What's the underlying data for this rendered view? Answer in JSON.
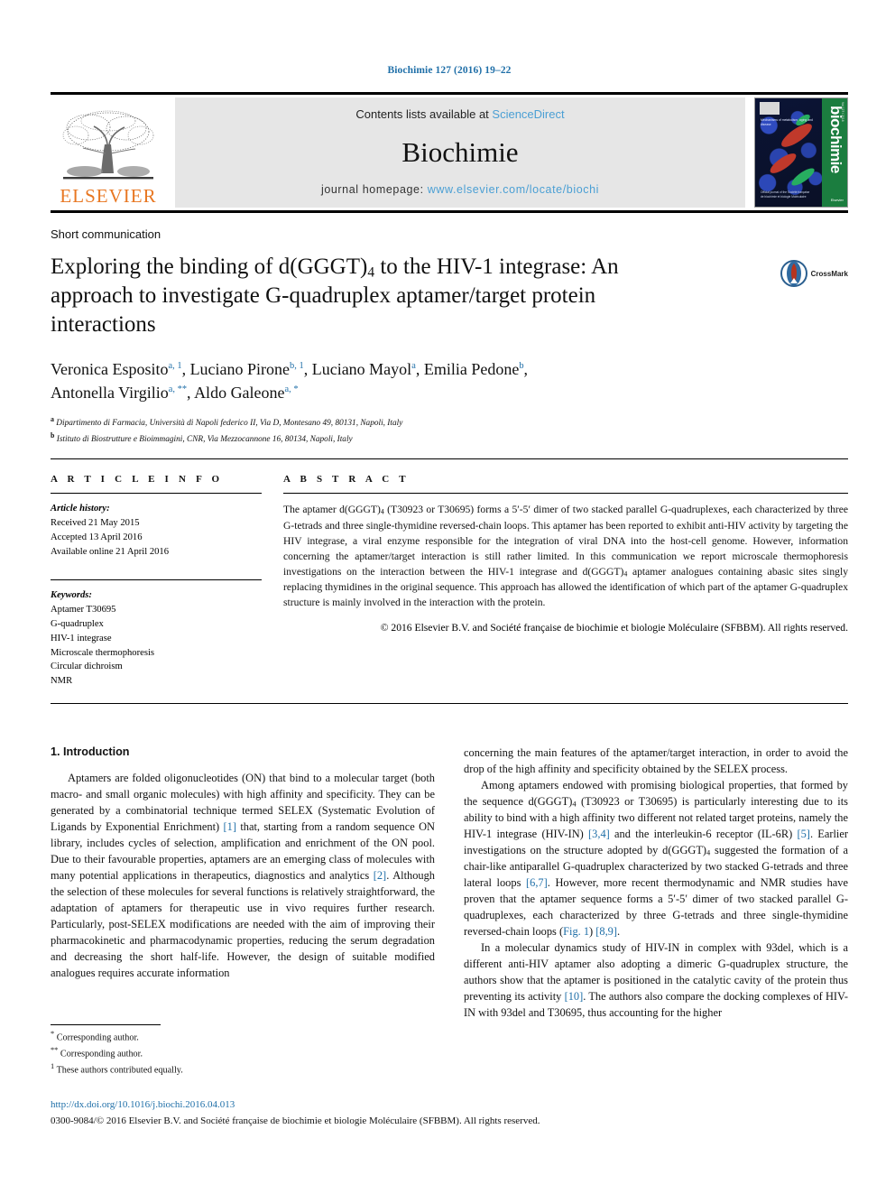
{
  "running_head": "Biochimie 127 (2016) 19–22",
  "masthead": {
    "publisher_name": "ELSEVIER",
    "contents_prefix": "Contents lists available at ",
    "contents_link": "ScienceDirect",
    "journal_name": "Biochimie",
    "homepage_label": "journal homepage: ",
    "homepage_url": "www.elsevier.com/locate/biochi",
    "cover_title": "biochimie",
    "cover_volume": "Vol 127 / 2016",
    "cover_caption": "Mechanisms of metabolism, aging and disease",
    "cover_caption2": "Official journal of the Société française de biochimie et biologie Moléculaire",
    "cover_badge": "Elsevier"
  },
  "article": {
    "type": "Short communication",
    "title_part1": "Exploring the binding of d(GGGT)",
    "title_sub1": "4",
    "title_part2": " to the HIV-1 integrase: An approach to investigate G-quadruplex aptamer/target protein interactions",
    "crossmark_label": "CrossMark"
  },
  "authors": {
    "line1": "Veronica Esposito",
    "line_html": "authors",
    "list": [
      {
        "name": "Veronica Esposito",
        "marks": "a, 1"
      },
      {
        "name": "Luciano Pirone",
        "marks": "b, 1"
      },
      {
        "name": "Luciano Mayol",
        "marks": "a"
      },
      {
        "name": "Emilia Pedone",
        "marks": "b"
      },
      {
        "name": "Antonella Virgilio",
        "marks": "a, **"
      },
      {
        "name": "Aldo Galeone",
        "marks": "a, *"
      }
    ],
    "affiliations": [
      {
        "mark": "a",
        "text": "Dipartimento di Farmacia, Università di Napoli federico II, Via D, Montesano 49, 80131, Napoli, Italy"
      },
      {
        "mark": "b",
        "text": "Istituto di Biostrutture e Bioimmagini, CNR, Via Mezzocannone 16, 80134, Napoli, Italy"
      }
    ]
  },
  "article_info": {
    "heading": "A R T I C L E  I N F O",
    "history_label": "Article history:",
    "history": [
      "Received 21 May 2015",
      "Accepted 13 April 2016",
      "Available online 21 April 2016"
    ],
    "keywords_label": "Keywords:",
    "keywords": [
      "Aptamer T30695",
      "G-quadruplex",
      "HIV-1 integrase",
      "Microscale thermophoresis",
      "Circular dichroism",
      "NMR"
    ]
  },
  "abstract": {
    "heading": "A B S T R A C T",
    "text_p1": "The aptamer d(GGGT)",
    "text_sub": "4",
    "text_p2": " (T30923 or T30695) forms a 5′-5′ dimer of two stacked parallel G-quadruplexes, each characterized by three G-tetrads and three single-thymidine reversed-chain loops. This aptamer has been reported to exhibit anti-HIV activity by targeting the HIV integrase, a viral enzyme responsible for the integration of viral DNA into the host-cell genome. However, information concerning the aptamer/target interaction is still rather limited. In this communication we report microscale thermophoresis investigations on the interaction between the HIV-1 integrase and d(GGGT)",
    "text_sub2": "4",
    "text_p3": " aptamer analogues containing abasic sites singly replacing thymidines in the original sequence. This approach has allowed the identification of which part of the aptamer G-quadruplex structure is mainly involved in the interaction with the protein.",
    "copyright": "© 2016 Elsevier B.V. and Société française de biochimie et biologie Moléculaire (SFBBM). All rights reserved."
  },
  "body": {
    "section1_heading": "1.  Introduction",
    "left_p1_a": "Aptamers are folded oligonucleotides (ON) that bind to a molecular target (both macro- and small organic molecules) with high affinity and specificity. They can be generated by a combinatorial technique termed SELEX (Systematic Evolution of Ligands by Exponential Enrichment) ",
    "left_p1_ref1": "[1]",
    "left_p1_b": " that, starting from a random sequence ON library, includes cycles of selection, amplification and enrichment of the ON pool. Due to their favourable properties, aptamers are an emerging class of molecules with many potential applications in therapeutics, diagnostics and analytics ",
    "left_p1_ref2": "[2]",
    "left_p1_c": ". Although the selection of these molecules for several functions is relatively straightforward, the adaptation of aptamers for therapeutic use in vivo requires further research. Particularly, post-SELEX modifications are needed with the aim of improving their pharmacokinetic and pharmacodynamic properties, reducing the serum degradation and decreasing the short half-life. However, the design of suitable modified analogues requires accurate information",
    "right_p1": "concerning the main features of the aptamer/target interaction, in order to avoid the drop of the high affinity and specificity obtained by the SELEX process.",
    "right_p2_a": "Among aptamers endowed with promising biological properties, that formed by the sequence d(GGGT)",
    "right_p2_sub": "4",
    "right_p2_b": " (T30923 or T30695) is particularly interesting due to its ability to bind with a high affinity two different not related target proteins, namely the HIV-1 integrase (HIV-IN) ",
    "right_p2_ref1": "[3,4]",
    "right_p2_c": " and the interleukin-6 receptor (IL-6R) ",
    "right_p2_ref2": "[5]",
    "right_p2_d": ". Earlier investigations on the structure adopted by d(GGGT)",
    "right_p2_sub2": "4",
    "right_p2_e": " suggested the formation of a chair-like antiparallel G-quadruplex characterized by two stacked G-tetrads and three lateral loops ",
    "right_p2_ref3": "[6,7]",
    "right_p2_f": ". However, more recent thermodynamic and NMR studies have proven that the aptamer sequence forms a 5′-5′ dimer of two stacked parallel G-quadruplexes, each characterized by three G-tetrads and three single-thymidine reversed-chain loops (",
    "right_p2_figref": "Fig. 1",
    "right_p2_g": ") ",
    "right_p2_ref4": "[8,9]",
    "right_p2_h": ".",
    "right_p3_a": "In a molecular dynamics study of HIV-IN in complex with 93del, which is a different anti-HIV aptamer also adopting a dimeric G-quadruplex structure, the authors show that the aptamer is positioned in the catalytic cavity of the protein thus preventing its activity ",
    "right_p3_ref1": "[10]",
    "right_p3_b": ". The authors also compare the docking complexes of HIV-IN with 93del and T30695, thus accounting for the higher"
  },
  "footnotes": [
    {
      "mark": "*",
      "text": "Corresponding author."
    },
    {
      "mark": "**",
      "text": "Corresponding author."
    },
    {
      "mark": "1",
      "text": "These authors contributed equally."
    }
  ],
  "bottom": {
    "doi": "http://dx.doi.org/10.1016/j.biochi.2016.04.013",
    "issn_line": "0300-9084/© 2016 Elsevier B.V. and Société française de biochimie et biologie Moléculaire (SFBBM). All rights reserved."
  },
  "colors": {
    "link_blue": "#1f6fa8",
    "sciencedirect_blue": "#4a9fd4",
    "elsevier_orange": "#E87722",
    "cover_green": "#1b7d3f"
  }
}
